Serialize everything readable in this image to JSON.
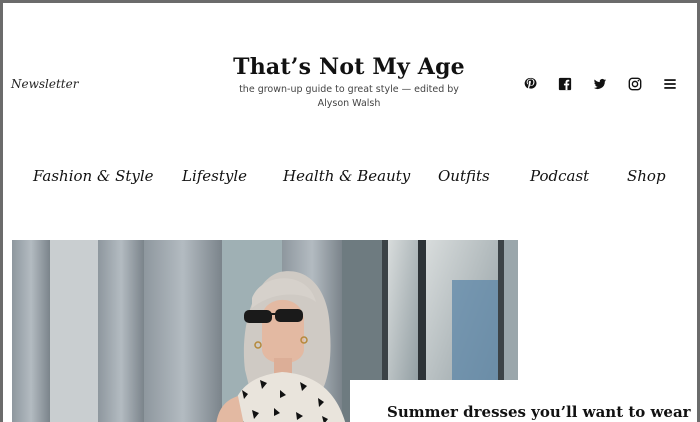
{
  "header": {
    "newsletter_link": "Newsletter",
    "site_title": "That’s Not My Age",
    "tagline": "the grown-up guide to great style — edited by Alyson Walsh"
  },
  "social_icons": [
    "pinterest-icon",
    "facebook-icon",
    "twitter-icon",
    "instagram-icon",
    "menu-icon"
  ],
  "nav": {
    "items": [
      {
        "label": "Fashion & Style"
      },
      {
        "label": "Lifestyle"
      },
      {
        "label": "Health & Beauty"
      },
      {
        "label": "Outfits"
      },
      {
        "label": "Podcast"
      },
      {
        "label": "Shop"
      }
    ]
  },
  "featured": {
    "title": "Summer dresses you’ll want to wear"
  },
  "colors": {
    "text": "#111111",
    "frame": "#6b6b6b",
    "background": "#ffffff"
  }
}
